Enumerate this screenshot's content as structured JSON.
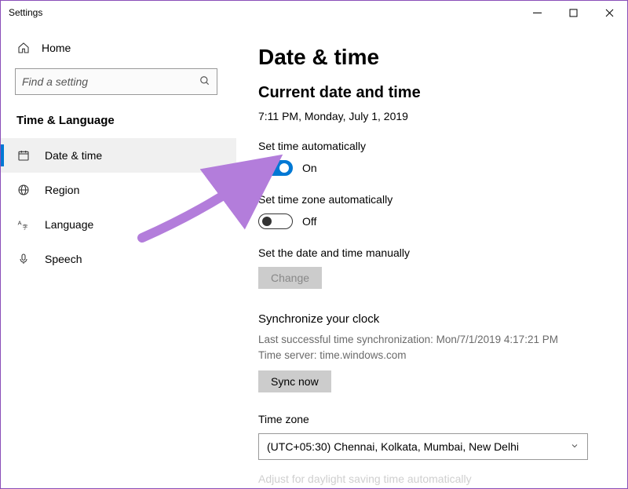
{
  "app_title": "Settings",
  "sidebar": {
    "home_label": "Home",
    "search_placeholder": "Find a setting",
    "section_title": "Time & Language",
    "items": [
      {
        "label": "Date & time",
        "active": true
      },
      {
        "label": "Region",
        "active": false
      },
      {
        "label": "Language",
        "active": false
      },
      {
        "label": "Speech",
        "active": false
      }
    ]
  },
  "main": {
    "page_title": "Date & time",
    "current_heading": "Current date and time",
    "current_value": "7:11 PM, Monday, July 1, 2019",
    "set_time_auto": {
      "label": "Set time automatically",
      "state": "On",
      "on": true
    },
    "set_tz_auto": {
      "label": "Set time zone automatically",
      "state": "Off",
      "on": false
    },
    "manual": {
      "label": "Set the date and time manually",
      "button": "Change",
      "button_enabled": false
    },
    "sync": {
      "heading": "Synchronize your clock",
      "last_line": "Last successful time synchronization: Mon/7/1/2019 4:17:21 PM",
      "server_line": "Time server: time.windows.com",
      "button": "Sync now"
    },
    "timezone": {
      "label": "Time zone",
      "value": "(UTC+05:30) Chennai, Kolkata, Mumbai, New Delhi"
    },
    "dst_label": "Adjust for daylight saving time automatically"
  },
  "colors": {
    "accent": "#0078d4",
    "arrow": "#b37ddb"
  }
}
